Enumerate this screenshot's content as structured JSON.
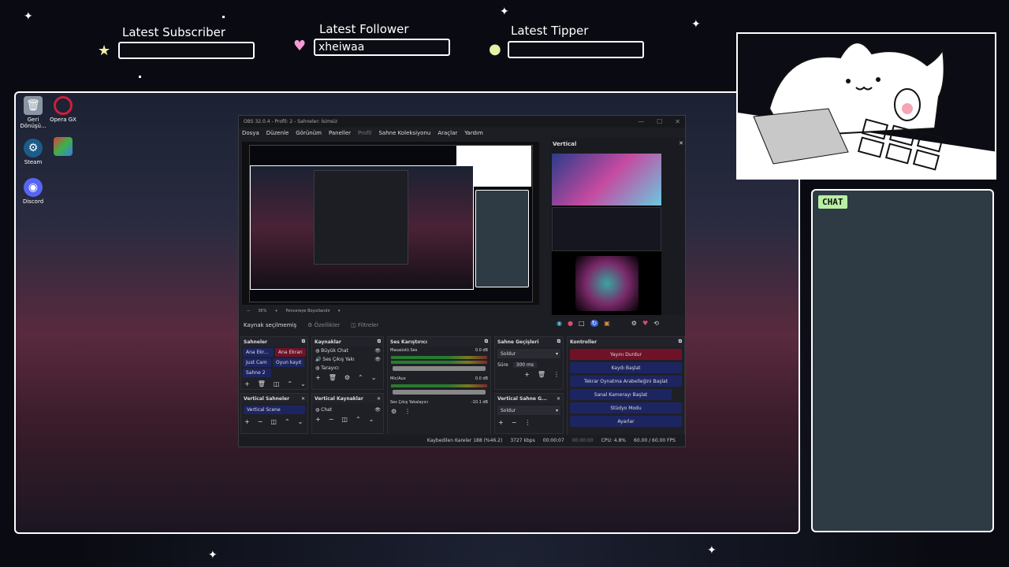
{
  "widgets": {
    "subscriber": {
      "label": "Latest Subscriber",
      "value": "",
      "icon": "star-icon"
    },
    "follower": {
      "label": "Latest Follower",
      "value": "xheiwaa",
      "icon": "heart-icon"
    },
    "tipper": {
      "label": "Latest Tipper",
      "value": "",
      "icon": "coin-icon"
    }
  },
  "desktop": {
    "icons": [
      {
        "label": "Geri Dönüşü...",
        "icon": "recycle-bin-icon"
      },
      {
        "label": "Opera GX",
        "icon": "opera-gx-icon"
      },
      {
        "label": "Steam",
        "icon": "steam-icon"
      },
      {
        "label": "",
        "icon": "app-icon"
      },
      {
        "label": "Discord",
        "icon": "discord-icon"
      }
    ]
  },
  "obs": {
    "title": "OBS 32.0.4 - Profil: 2 - Sahneler: İsimsiz",
    "menu": [
      "Dosya",
      "Düzenle",
      "Görünüm",
      "Paneller",
      "Profil",
      "Sahne Koleksiyonu",
      "Araçlar",
      "Yardım"
    ],
    "zoom": "36%",
    "fit_label": "Pencereye Boyutlandır",
    "source_status": "Kaynak seçilmemiş",
    "properties_label": "Özellikler",
    "filters_label": "Filtreler",
    "vertical_title": "Vertical",
    "scenes": {
      "title": "Sahneler",
      "items": [
        "Ana Ekr...",
        "Ana Ekran",
        "Just Cam",
        "Oyun kayıt",
        "Sahne 2"
      ]
    },
    "sources": {
      "title": "Kaynaklar",
      "items": [
        "Büyük Chat",
        "Ses Çıkış Yakı",
        "Tarayıcı"
      ]
    },
    "mixer": {
      "title": "Ses Karıştırıcı",
      "channels": [
        {
          "name": "Masaüstü Ses",
          "db": "0.0 dB"
        },
        {
          "name": "Mic/Aux",
          "db": "0.0 dB"
        },
        {
          "name": "Ses Çıkış Yakalayıcı",
          "db": "-10.1 dB"
        }
      ]
    },
    "transitions": {
      "title": "Sahne Geçişleri",
      "type": "Soldur",
      "duration_label": "Süre",
      "duration": "300 ms"
    },
    "controls": {
      "title": "Kontroller",
      "buttons": [
        "Yayını Durdur",
        "Kaydı Başlat",
        "Tekrar Oynatma Arabelleğini Başlat",
        "Sanal Kamerayı Başlat",
        "Stüdyo Modu",
        "Ayarlar"
      ]
    },
    "vertical_scenes": {
      "title": "Vertical Sahneler",
      "items": [
        "Vertical Scene"
      ]
    },
    "vertical_sources": {
      "title": "Vertical Kaynaklar",
      "items": [
        "Chat"
      ]
    },
    "vertical_transitions": {
      "title": "Vertical Sahne G...",
      "type": "Soldur"
    },
    "status": {
      "dropped": "Kaybedilen Kareler 188 (%46.2)",
      "bitrate": "3727 kbps",
      "stream_time": "00:00:07",
      "rec_time": "00:00:00",
      "cpu": "CPU: 4.8%",
      "fps": "60.00 / 60.00 FPS"
    }
  },
  "chat": {
    "tag": "CHAT"
  },
  "colors": {
    "accent_green": "#b7f0a4",
    "button_blue": "#1d2561",
    "button_red": "#6f1228",
    "chat_bg": "#2e3a44"
  }
}
